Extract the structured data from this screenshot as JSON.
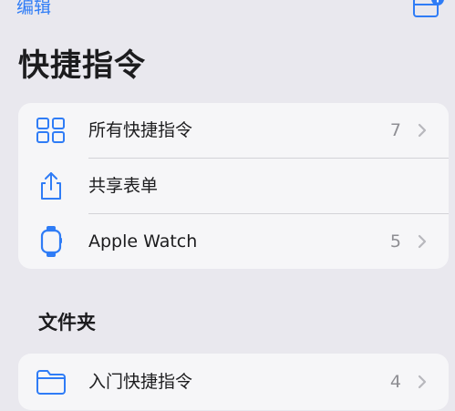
{
  "toolbar": {
    "edit_label": "编辑",
    "new_folder_icon": "folder-badge-plus-icon"
  },
  "title": "快捷指令",
  "library": {
    "items": [
      {
        "label": "所有快捷指令",
        "count": "7",
        "icon": "grid-icon"
      },
      {
        "label": "共享表单",
        "count": "",
        "icon": "share-icon"
      },
      {
        "label": "Apple Watch",
        "count": "5",
        "icon": "apple-watch-icon"
      }
    ]
  },
  "folders": {
    "section_title": "文件夹",
    "items": [
      {
        "label": "入门快捷指令",
        "count": "4",
        "icon": "folder-icon"
      }
    ]
  },
  "colors": {
    "accent": "#2f7cf6",
    "background": "#e9e8ee",
    "card": "#f6f6f8",
    "secondary_text": "#8e8e93"
  }
}
